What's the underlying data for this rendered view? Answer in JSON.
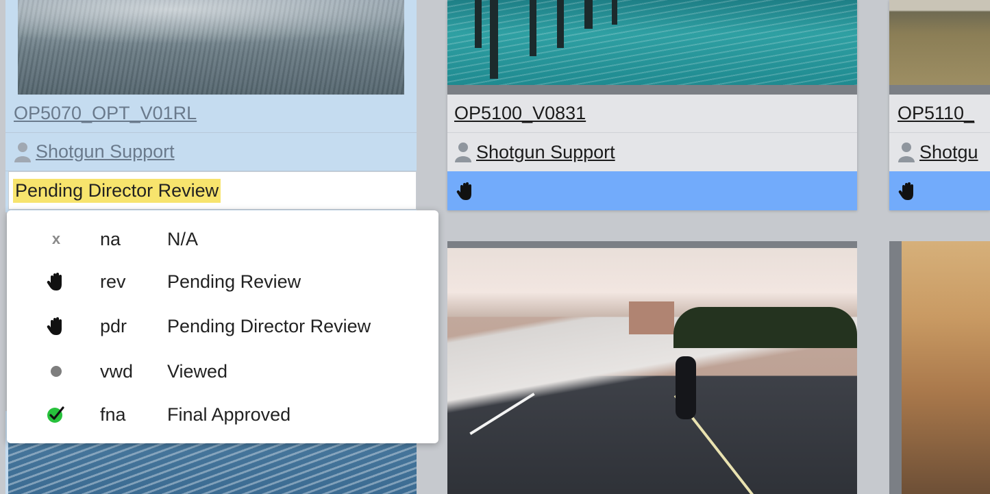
{
  "cards": [
    {
      "name": "OP5070_OPT_V01RL",
      "artist": "Shotgun Support",
      "status_value": "Pending Director Review",
      "selected": true
    },
    {
      "name": "OP5100_V0831",
      "artist": "Shotgun Support",
      "status_icon": "hand-icon"
    },
    {
      "name": "OP5110_",
      "artist": "Shotgu",
      "status_icon": "hand-icon"
    }
  ],
  "status_menu": {
    "options": [
      {
        "icon": "x-icon",
        "code": "na",
        "label": "N/A"
      },
      {
        "icon": "hand-icon",
        "code": "rev",
        "label": "Pending Review"
      },
      {
        "icon": "hand-icon",
        "code": "pdr",
        "label": "Pending Director Review"
      },
      {
        "icon": "dot-icon",
        "code": "vwd",
        "label": "Viewed"
      },
      {
        "icon": "check-icon",
        "code": "fna",
        "label": "Final Approved"
      }
    ]
  },
  "colors": {
    "background": "#c6c9ce",
    "card_row": "#e4e5e8",
    "selected_card": "#c5dcf0",
    "status_blue": "#72abfb",
    "highlight_yellow": "#f7e46d",
    "approved_green": "#27c13c"
  }
}
